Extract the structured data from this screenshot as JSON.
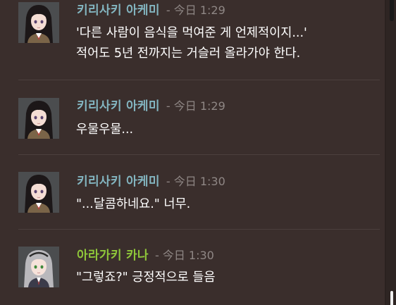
{
  "messages": [
    {
      "author": "키리사키 아케미",
      "author_color": "#83b5c0",
      "separator": " - ",
      "time": "今日 1:29",
      "lines": [
        "'다른 사람이 음식을 먹여준 게 언제적이지...'",
        "적어도 5년 전까지는 거슬러 올라가야 한다."
      ],
      "avatar": "akemi-avatar"
    },
    {
      "author": "키리사키 아케미",
      "author_color": "#83b5c0",
      "separator": " - ",
      "time": "今日 1:29",
      "lines": [
        "우물우물..."
      ],
      "avatar": "akemi-avatar"
    },
    {
      "author": "키리사키 아케미",
      "author_color": "#83b5c0",
      "separator": " - ",
      "time": "今日 1:30",
      "lines": [
        "\"...달콤하네요.\" 너무."
      ],
      "avatar": "akemi-avatar"
    },
    {
      "author": "아라가키 카나",
      "author_color": "#8fc73a",
      "separator": " - ",
      "time": "今日 1:30",
      "lines": [
        "\"그렇죠?\" 긍정적으로 들음"
      ],
      "avatar": "kana-avatar"
    }
  ],
  "colors": {
    "background": "#3a2e2c",
    "divider": "#4c403e",
    "timestamp": "#8f8785",
    "message_text": "#ffffff"
  }
}
